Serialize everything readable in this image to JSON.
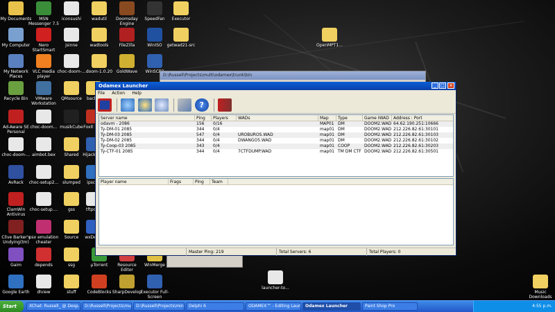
{
  "desktop": {
    "icons": [
      {
        "label": "My Documents",
        "color": "#e8c24a"
      },
      {
        "label": "MSN Messenger 7.5",
        "color": "#3a8e3a"
      },
      {
        "label": "iconsushi",
        "color": "#e8e8e8"
      },
      {
        "label": "wadutil",
        "color": "#f0d060"
      },
      {
        "label": "Doomsday Engine",
        "color": "#8a4a20"
      },
      {
        "label": "SpeedFan",
        "color": "#333333"
      },
      {
        "label": "Executor",
        "color": "#f0d060"
      },
      {
        "label": "My Computer",
        "color": "#7aa0d0"
      },
      {
        "label": "Nero StartSmart",
        "color": "#d02020"
      },
      {
        "label": "jsinne",
        "color": "#e8e8e8"
      },
      {
        "label": "wadtools",
        "color": "#f0d060"
      },
      {
        "label": "FileZilla",
        "color": "#b02020"
      },
      {
        "label": "WinISO",
        "color": "#2050a0"
      },
      {
        "label": "getwad21-src",
        "color": "#f0d060"
      },
      {
        "label": "My Network Places",
        "color": "#5a80c0"
      },
      {
        "label": "VLC media player",
        "color": "#f08020"
      },
      {
        "label": "choc-doom-...",
        "color": "#e8e8e8"
      },
      {
        "label": "doom-1.0.20",
        "color": "#f0d060"
      },
      {
        "label": "GoldWave",
        "color": "#d0b030"
      },
      {
        "label": "WinSCP3",
        "color": "#3060b0"
      },
      {
        "label": "Recycle Bin",
        "color": "#6aa040"
      },
      {
        "label": "VMware Workstation",
        "color": "#4070a0"
      },
      {
        "label": "QMsource",
        "color": "#f0d060"
      },
      {
        "label": "back...",
        "color": "#f0d060"
      },
      {
        "label": "Ad-Aware SE Personal",
        "color": "#c02020"
      },
      {
        "label": "choc-doom...",
        "color": "#e8e8e8"
      },
      {
        "label": "musikCube",
        "color": "#202020"
      },
      {
        "label": "Foxit Re...",
        "color": "#c03020"
      },
      {
        "label": "choc-doom-...",
        "color": "#e8e8e8"
      },
      {
        "label": "aimbot.bex",
        "color": "#e8e8e8"
      },
      {
        "label": "Shared",
        "color": "#f0d060"
      },
      {
        "label": "HijackTh...",
        "color": "#3060b0"
      },
      {
        "label": "AvRack",
        "color": "#3050a0"
      },
      {
        "label": "choc-setup2...",
        "color": "#e8e8e8"
      },
      {
        "label": "slumped",
        "color": "#f0d060"
      },
      {
        "label": "ipscan",
        "color": "#3070c0"
      },
      {
        "label": "ClamWin Antivirus",
        "color": "#c02020"
      },
      {
        "label": "choc-setup....",
        "color": "#e8e8e8"
      },
      {
        "label": "gss",
        "color": "#f0d060"
      },
      {
        "label": "tftpd32",
        "color": "#e8e8e8"
      },
      {
        "label": "Clive Barker's Undying(tm)",
        "color": "#802020"
      },
      {
        "label": "psx emulation cheater",
        "color": "#c03070"
      },
      {
        "label": "Source",
        "color": "#f0d060"
      },
      {
        "label": "wxDev...",
        "color": "#3060c0"
      },
      {
        "label": "Gaim",
        "color": "#8050c0"
      },
      {
        "label": "depends",
        "color": "#d03030"
      },
      {
        "label": "ssg",
        "color": "#f0d060"
      },
      {
        "label": "µTorrent",
        "color": "#3a9a3a"
      },
      {
        "label": "Resource Editor",
        "color": "#d04040"
      },
      {
        "label": "WinMerge",
        "color": "#e0c040"
      },
      {
        "label": "Google Earth",
        "color": "#3070c0"
      },
      {
        "label": "dlview",
        "color": "#e8e8e8"
      },
      {
        "label": "stuff",
        "color": "#f0d060"
      },
      {
        "label": "CodeBlocks",
        "color": "#d04020"
      },
      {
        "label": "SharpDevelop",
        "color": "#c0a030"
      },
      {
        "label": "Executor Full-Screen",
        "color": "#3060b0"
      },
      {
        "label": "OpenMPT1...",
        "color": "#f0d060"
      },
      {
        "label": "Music Downloads",
        "color": "#f0d060"
      },
      {
        "label": "launcher-to...",
        "color": "#e8e8e8"
      }
    ],
    "bg_window_title": "D:\\Russell\\Projects\\multi\\odamex\\trunk\\bin"
  },
  "window": {
    "title": "Odamex Launcher",
    "menu": [
      "File",
      "Action",
      "Help"
    ],
    "toolbar_icons": [
      "odamex-logo-icon",
      "refresh-icon",
      "refresh-all-icon",
      "custom-query-icon",
      "settings-icon",
      "help-icon",
      "exit-icon"
    ],
    "server_columns": [
      "Server name",
      "Ping",
      "Players",
      "WADs",
      "Map",
      "Type",
      "Game IWAD",
      "Address : Port"
    ],
    "servers": [
      {
        "name": "odavm - 2086",
        "ping": "156",
        "players": "0/16",
        "wads": "",
        "map": "MAP01",
        "type": "DM",
        "iwad": "DOOM2.WAD",
        "address": "64.62.190.251:10666"
      },
      {
        "name": "Ty-DM-01 2085",
        "ping": "344",
        "players": "0/4",
        "wads": "",
        "map": "map01",
        "type": "DM",
        "iwad": "DOOM2.WAD",
        "address": "212.226.82.61:30101"
      },
      {
        "name": "Ty-DM-03 2085",
        "ping": "547",
        "players": "0/4",
        "wads": "UROBUROS.WAD",
        "map": "map01",
        "type": "DM",
        "iwad": "DOOM2.WAD",
        "address": "212.226.82.61:30103"
      },
      {
        "name": "Ty-DM-02 2085",
        "ping": "344",
        "players": "0/4",
        "wads": "DWANGO5.WAD",
        "map": "map01",
        "type": "DM",
        "iwad": "DOOM2.WAD",
        "address": "212.226.82.61:30102"
      },
      {
        "name": "Ty-Coop-03 2085",
        "ping": "343",
        "players": "0/4",
        "wads": "",
        "map": "map01",
        "type": "COOP",
        "iwad": "DOOM2.WAD",
        "address": "212.226.82.61:30203"
      },
      {
        "name": "Ty-CTF-01 2085",
        "ping": "344",
        "players": "0/4",
        "wads": "7CTFDUMP.WAD",
        "map": "map01",
        "type": "TM DM CTF",
        "iwad": "DOOM2.WAD",
        "address": "212.226.82.61:30501"
      }
    ],
    "player_columns": [
      "Player name",
      "Frags",
      "Ping",
      "Team"
    ],
    "status": {
      "master_ping": "Master Ping: 219",
      "total_servers": "Total Servers: 6",
      "total_players": "Total Players: 0"
    }
  },
  "taskbar": {
    "start_label": "Start",
    "tasks": [
      {
        "label": "XChat: Russell_ @ Desp..."
      },
      {
        "label": "D:\\Russell\\Projects\\multi\\..."
      },
      {
        "label": "D:\\Russell\\Projects\\ming..."
      },
      {
        "label": "Delphi 6"
      },
      {
        "label": "ODAMEX™ - Editing Launc..."
      },
      {
        "label": "Odamex Launcher"
      },
      {
        "label": "Paint Shop Pro"
      }
    ],
    "clock": "4:55 p.m."
  }
}
